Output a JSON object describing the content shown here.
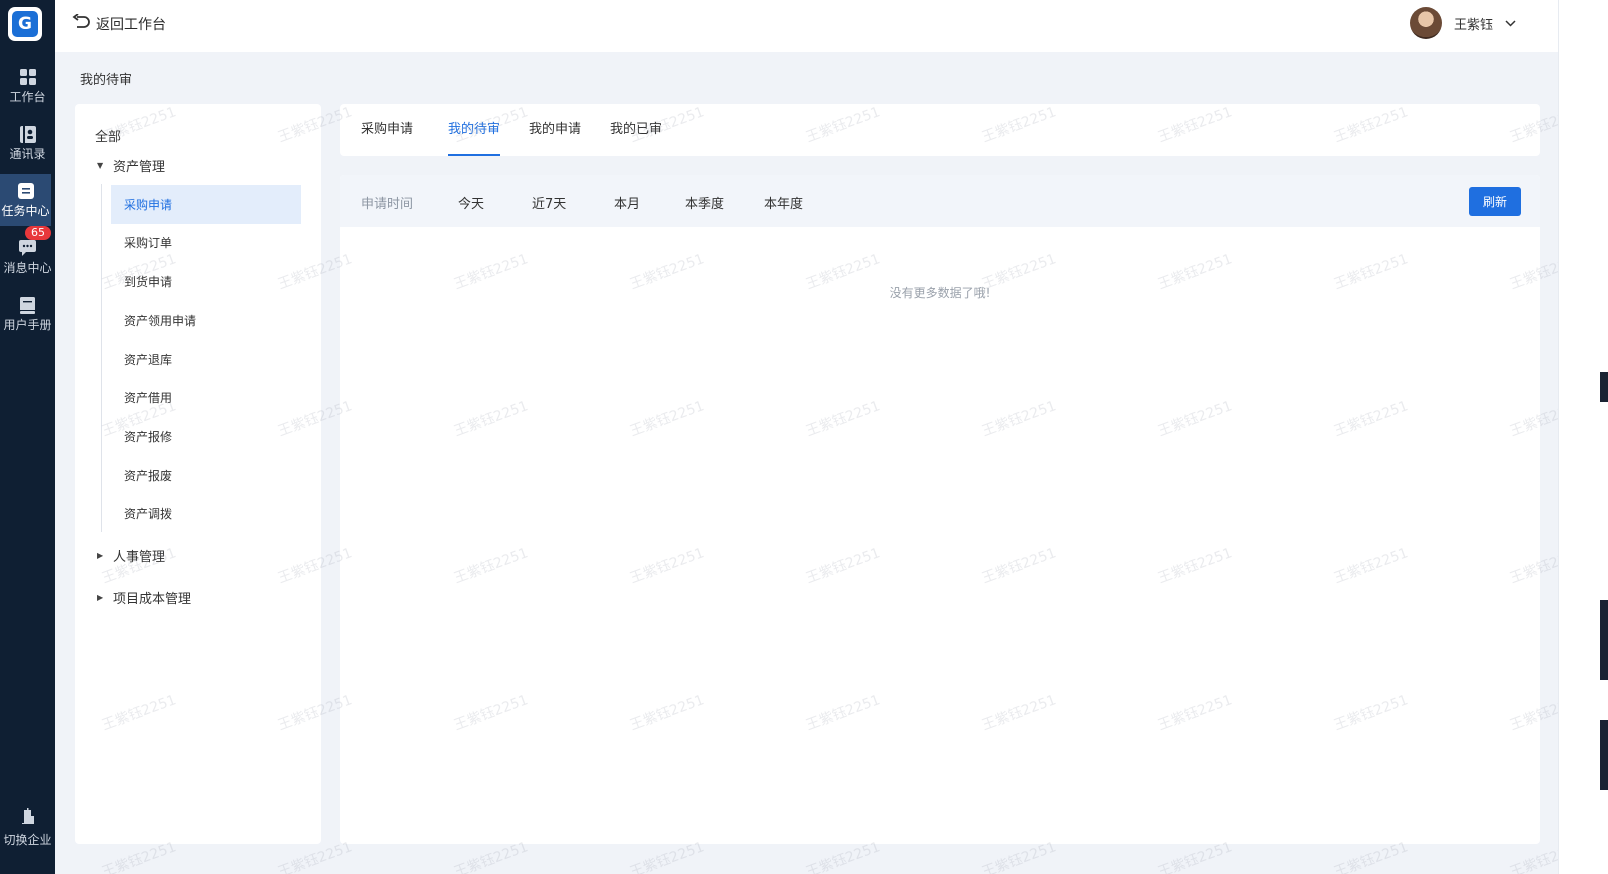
{
  "rail": {
    "items": [
      {
        "label": "工作台",
        "icon": "grid-icon"
      },
      {
        "label": "通讯录",
        "icon": "contacts-icon"
      },
      {
        "label": "任务中心",
        "icon": "task-icon"
      },
      {
        "label": "消息中心",
        "icon": "chat-icon"
      },
      {
        "label": "用户手册",
        "icon": "book-icon"
      }
    ],
    "message_badge": "65",
    "switch_label": "切换企业"
  },
  "header": {
    "back_label": "返回工作台",
    "user_name": "王紫钰"
  },
  "breadcrumb": "我的待审",
  "tree": {
    "all": "全部",
    "group1": "资产管理",
    "leaves": [
      "采购申请",
      "采购订单",
      "到货申请",
      "资产领用申请",
      "资产退库",
      "资产借用",
      "资产报修",
      "资产报废",
      "资产调拨"
    ],
    "group2": "人事管理",
    "group3": "项目成本管理"
  },
  "tabs": [
    "采购申请",
    "我的待审",
    "我的申请",
    "我的已审"
  ],
  "filter": {
    "label": "申请时间",
    "options": [
      "今天",
      "近7天",
      "本月",
      "本季度",
      "本年度"
    ],
    "refresh": "刷新"
  },
  "empty_text": "没有更多数据了哦!",
  "watermark": "王紫钰2251",
  "colors": {
    "accent": "#1f6fe0",
    "rail": "#0f1f33",
    "badge": "#e8373b"
  }
}
